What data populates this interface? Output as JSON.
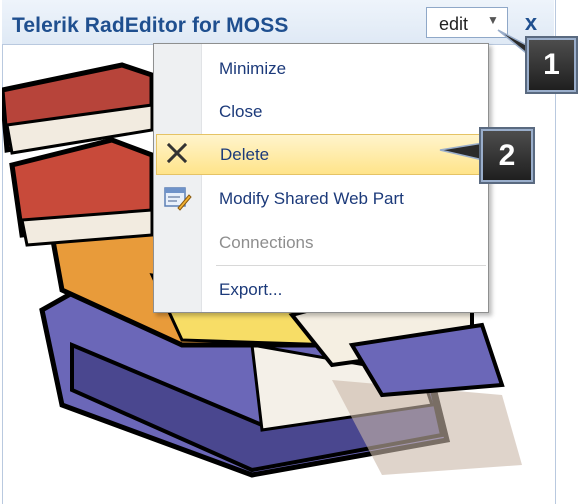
{
  "webpart": {
    "title": "Telerik RadEditor for MOSS",
    "edit_label": "edit",
    "caret_icon": "chevron-down-icon",
    "close_glyph": "x"
  },
  "menu": {
    "items": [
      {
        "label": "Minimize",
        "icon": "",
        "state": "normal"
      },
      {
        "label": "Close",
        "icon": "",
        "state": "normal"
      },
      {
        "label": "Delete",
        "icon": "x-icon",
        "state": "hover"
      },
      {
        "label": "Modify Shared Web Part",
        "icon": "edit-properties-icon",
        "state": "normal"
      },
      {
        "label": "Connections",
        "icon": "",
        "state": "disabled"
      },
      {
        "label": "Export...",
        "icon": "",
        "state": "normal"
      }
    ]
  },
  "callouts": [
    {
      "label": "1"
    },
    {
      "label": "2"
    }
  ],
  "colors": {
    "title": "#1f4f8f",
    "menu_text": "#1c3a7a",
    "hover_bg": "#ffe48a",
    "callout_bg": "#2b2b2b"
  }
}
